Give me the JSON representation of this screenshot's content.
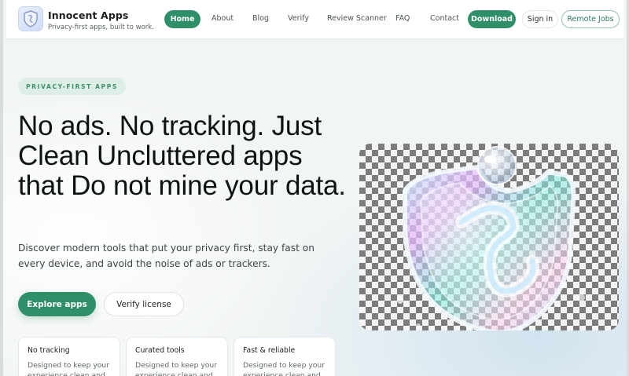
{
  "brand": {
    "name": "Innocent Apps",
    "tagline": "Privacy-first apps, built to work."
  },
  "nav": {
    "home": "Home",
    "about": "About",
    "blog": "Blog",
    "verify": "Verify",
    "review_scanner": "Review Scanner",
    "faq": "FAQ",
    "contact": "Contact",
    "download": "Download",
    "sign_in": "Sign in",
    "remote_jobs": "Remote Jobs"
  },
  "hero": {
    "badge": "PRIVACY-FIRST APPS",
    "headline": "No ads. No tracking. Just Clean Uncluttered apps that Do not mine your data.",
    "subtext": "Discover modern tools that put your privacy first, stay fast on every device, and avoid the noise of ads or trackers.",
    "primary_button": "Explore apps",
    "secondary_button": "Verify license",
    "image_icon": "glass-shield-logo-icon"
  },
  "features": [
    {
      "title": "No tracking",
      "desc": "Designed to keep your experience clean and"
    },
    {
      "title": "Curated tools",
      "desc": "Designed to keep your experience clean and"
    },
    {
      "title": "Fast & reliable",
      "desc": "Designed to keep your experience clean and"
    }
  ],
  "colors": {
    "accent": "#2e8f68",
    "badge_bg": "#dceee6",
    "badge_text": "#3f8f6d"
  }
}
